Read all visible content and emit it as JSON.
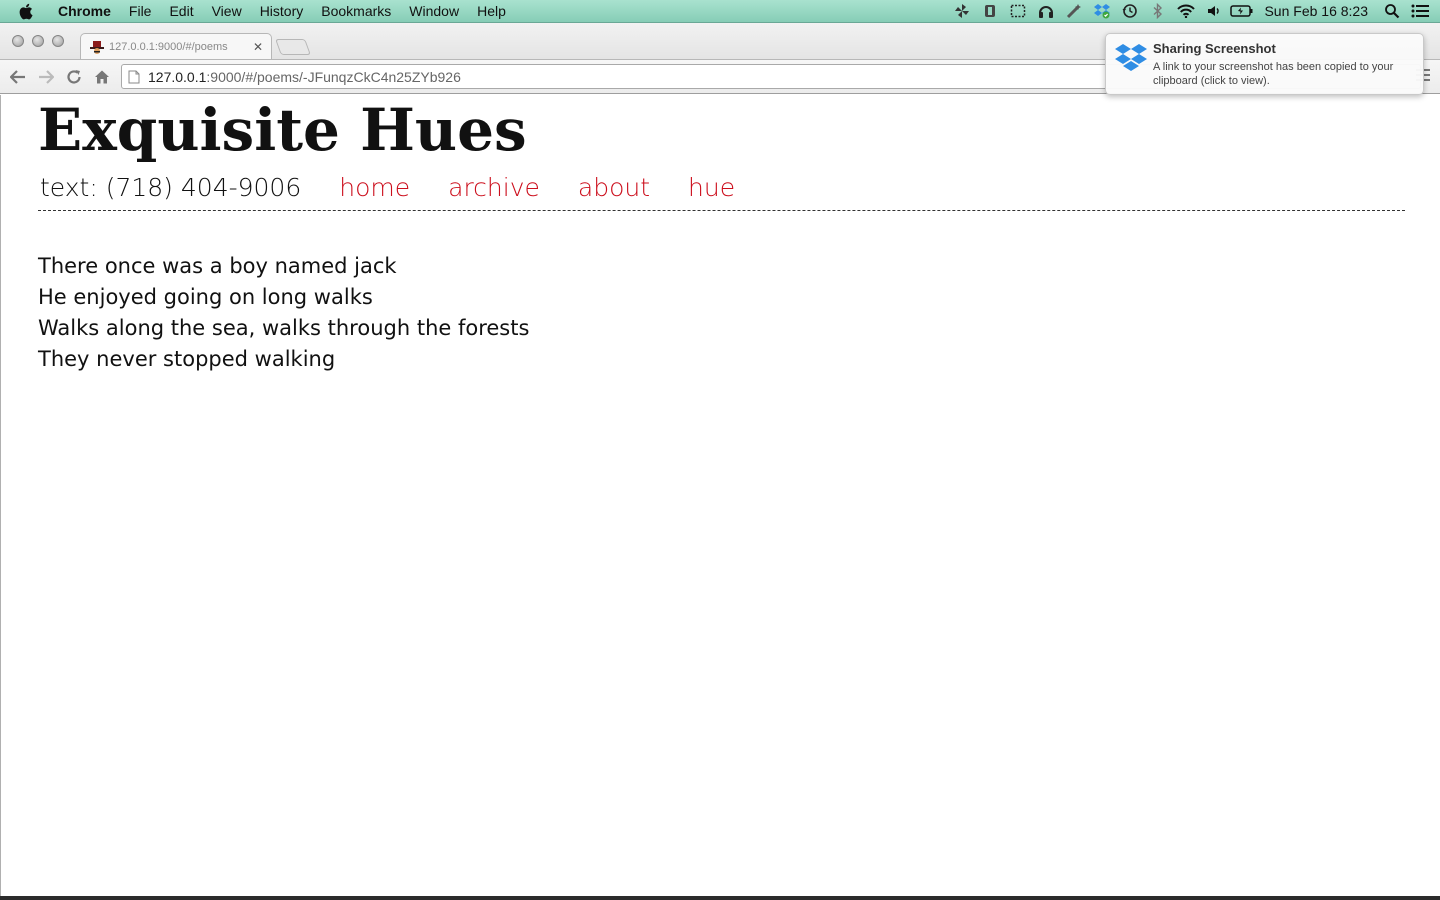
{
  "menubar": {
    "app_name": "Chrome",
    "items": [
      "File",
      "Edit",
      "View",
      "History",
      "Bookmarks",
      "Window",
      "Help"
    ],
    "status_icons": [
      "pinwheel-icon",
      "evernote-icon",
      "screenshot-icon",
      "headphones-icon",
      "wand-icon",
      "dropbox-icon",
      "time-machine-icon",
      "bluetooth-icon",
      "wifi-icon",
      "volume-icon",
      "battery-icon"
    ],
    "clock": "Sun Feb 16  8:23"
  },
  "browser": {
    "tab_title": "127.0.0.1:9000/#/poems",
    "url_host": "127.0.0.1",
    "url_path": ":9000/#/poems/-JFunqzCkC4n25ZYb926"
  },
  "site": {
    "title": "Exquisite Hues",
    "phone": "text: (718) 404-9006",
    "nav": [
      "home",
      "archive",
      "about",
      "hue"
    ],
    "link_color": "#cc0e1c"
  },
  "poem": {
    "lines": [
      "There once was a boy named jack",
      "He enjoyed going on long walks",
      "Walks along the sea, walks through the forests",
      "They never stopped walking"
    ]
  },
  "notification": {
    "title": "Sharing Screenshot",
    "body": "A link to your screenshot has been copied to your clipboard (click to view)."
  },
  "colors": {
    "menubar": "#97d8c3",
    "accent_red": "#cc0e1c",
    "dropbox_blue": "#2f8de4"
  }
}
